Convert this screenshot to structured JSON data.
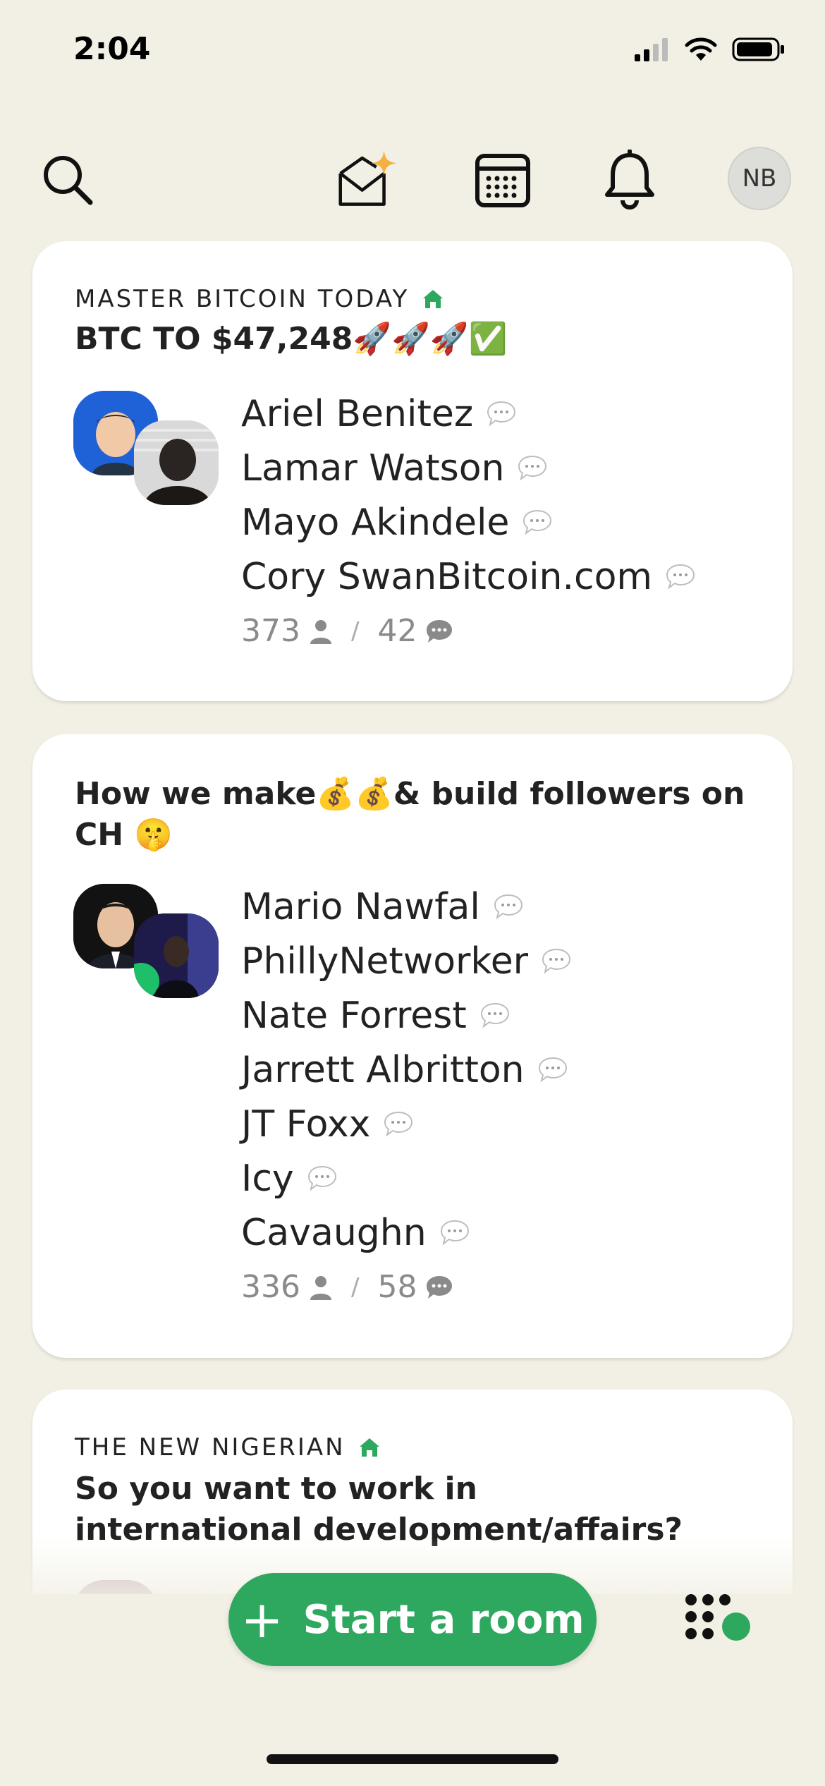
{
  "status_bar": {
    "time": "2:04"
  },
  "top_nav": {
    "search_icon": "search-icon",
    "invite_icon": "envelope-sparkle-icon",
    "calendar_icon": "calendar-icon",
    "notifications_icon": "bell-icon",
    "profile_initials": "NB"
  },
  "rooms": [
    {
      "club": "MASTER BITCOIN TODAY",
      "title": "BTC TO $47,248🚀🚀🚀✅",
      "speakers": [
        "Ariel Benitez",
        "Lamar Watson",
        "Mayo Akindele",
        "Cory SwanBitcoin.com"
      ],
      "listeners": "373",
      "speaker_count": "42"
    },
    {
      "club": "",
      "title": "How we make💰💰& build followers on CH 🤫",
      "speakers": [
        "Mario Nawfal",
        "PhillyNetworker",
        "Nate Forrest",
        "Jarrett Albritton",
        "JT Foxx",
        "Icy",
        "Cavaughn"
      ],
      "listeners": "336",
      "speaker_count": "58"
    },
    {
      "club": "THE NEW NIGERIAN",
      "title": "So you want to work in international development/affairs?",
      "speakers": [],
      "listeners": "",
      "speaker_count": ""
    }
  ],
  "bottom": {
    "start_room_plus": "+",
    "start_room_label": "Start a room"
  },
  "colors": {
    "background": "#F2F0E4",
    "accent_green": "#2FA85F",
    "card": "#FFFFFF",
    "muted": "#8A8A8A"
  }
}
